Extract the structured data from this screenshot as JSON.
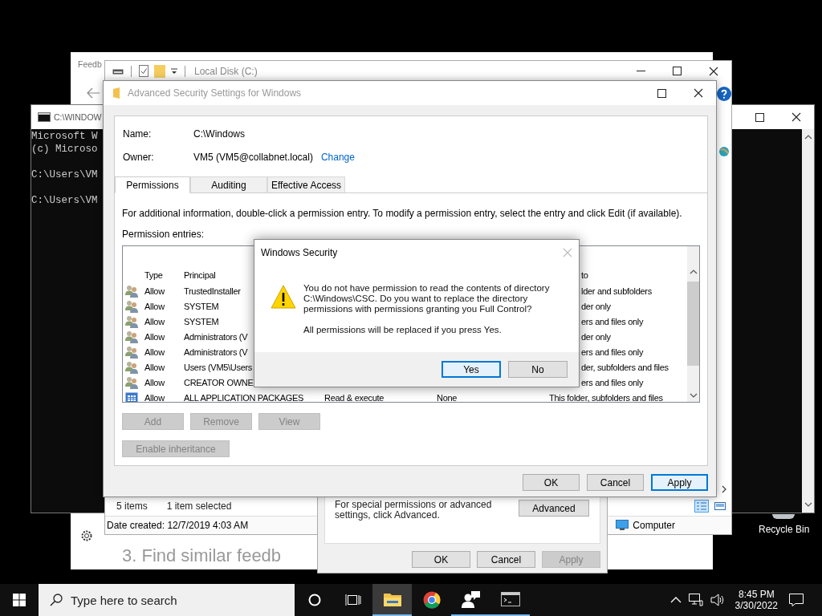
{
  "desktop": {
    "icon_label": "Recycle Bin"
  },
  "feedback_window": {
    "title": "Feedb",
    "heading": "3. Find similar feedb"
  },
  "console_window": {
    "title": "C:\\WINDOW",
    "paragraphs": [
      [
        "Microsoft W",
        "(c) Microso"
      ],
      [
        "C:\\Users\\VM"
      ],
      [
        "C:\\Users\\VM"
      ]
    ]
  },
  "explorer_window": {
    "title": "Local Disk (C:)",
    "item_count": "5 items",
    "selection": "1 item selected",
    "date_created": "Date created: 12/7/2019 4:03 AM",
    "location": "Computer"
  },
  "properties_dialog": {
    "text": "For special permissions or advanced settings, click Advanced.",
    "advanced_button": "Advanced",
    "buttons": [
      {
        "label": "OK",
        "disabled": false
      },
      {
        "label": "Cancel",
        "disabled": false
      },
      {
        "label": "Apply",
        "disabled": true
      }
    ]
  },
  "security_window": {
    "title": "Advanced Security Settings for Windows",
    "name_label": "Name:",
    "name": "C:\\Windows",
    "owner_label": "Owner:",
    "owner": "VM5 (VM5@collabnet.local)",
    "change_link": "Change",
    "tabs": [
      {
        "label": "Permissions",
        "selected": true
      },
      {
        "label": "Auditing",
        "selected": false
      },
      {
        "label": "Effective Access",
        "selected": false
      }
    ],
    "instructions": "For additional information, double-click a permission entry. To modify a permission entry, select the entry and click Edit (if available).",
    "entries_label": "Permission entries:",
    "columns": {
      "type": "Type",
      "principal": "Principal",
      "applies_to": "to",
      "applies_clipped": true
    },
    "rows": [
      {
        "kind": "users",
        "type": "Allow",
        "principal": "TrustedInstaller",
        "applies_to": "lder and subfolders",
        "applies_clipped": true
      },
      {
        "kind": "users",
        "type": "Allow",
        "principal": "SYSTEM",
        "applies_to": "der only",
        "applies_clipped": true
      },
      {
        "kind": "users",
        "type": "Allow",
        "principal": "SYSTEM",
        "applies_to": "ers and files only",
        "applies_clipped": true
      },
      {
        "kind": "users",
        "type": "Allow",
        "principal": "Administrators (V",
        "applies_to": "der only",
        "applies_clipped": true
      },
      {
        "kind": "users",
        "type": "Allow",
        "principal": "Administrators (V",
        "applies_to": "ers and files only",
        "applies_clipped": true
      },
      {
        "kind": "users",
        "type": "Allow",
        "principal": "Users (VM5\\Users",
        "applies_to": "der, subfolders and files",
        "applies_clipped": true
      },
      {
        "kind": "users",
        "type": "Allow",
        "principal": "CREATOR OWNE",
        "applies_to": "ers and files only",
        "applies_clipped": true
      },
      {
        "kind": "package",
        "type": "Allow",
        "principal": "ALL APPLICATION PACKAGES",
        "access": "Read & execute",
        "inherited_from": "None",
        "applies_to": "This folder, subfolders and files",
        "applies_clipped": false
      }
    ],
    "entry_buttons": [
      {
        "label": "Add",
        "disabled": true
      },
      {
        "label": "Remove",
        "disabled": true
      },
      {
        "label": "View",
        "disabled": true
      }
    ],
    "inheritance_button": {
      "label": "Enable inheritance",
      "disabled": true
    },
    "buttons": [
      {
        "label": "OK",
        "default": false
      },
      {
        "label": "Cancel",
        "default": false
      },
      {
        "label": "Apply",
        "default": true
      }
    ]
  },
  "security_prompt": {
    "title": "Windows Security",
    "message": "You do not have permission to read the contents of directory C:\\Windows\\CSC. Do you want to replace the directory permissions with permissions granting you Full Control?",
    "note": "All permissions will be replaced if you press Yes.",
    "buttons": [
      {
        "label": "Yes",
        "default": true
      },
      {
        "label": "No",
        "default": false
      }
    ]
  },
  "taskbar": {
    "search": {
      "placeholder": "Type here to search"
    },
    "apps": [
      {
        "kind": "explorer",
        "active": true,
        "running": true
      },
      {
        "kind": "chrome",
        "active": false,
        "running": false
      },
      {
        "kind": "people",
        "active": false,
        "running": true
      },
      {
        "kind": "console",
        "active": false,
        "running": true
      }
    ],
    "time": "8:45 PM",
    "date": "3/30/2022"
  }
}
